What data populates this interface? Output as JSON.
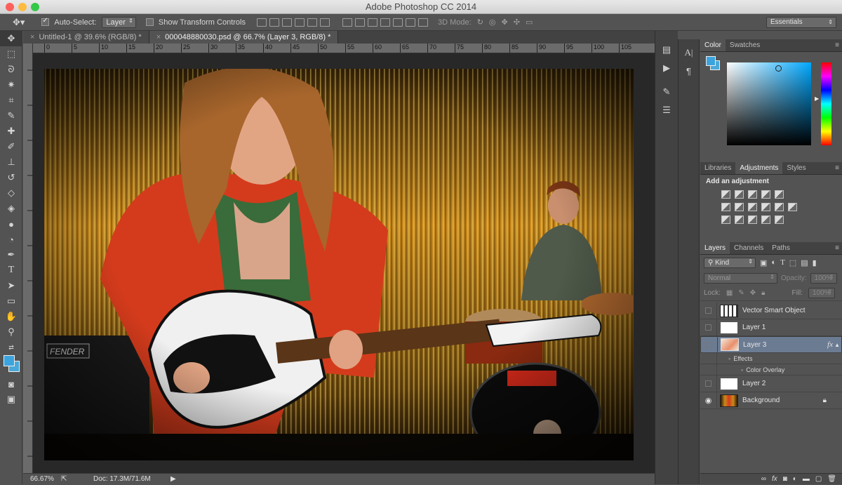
{
  "window": {
    "title": "Adobe Photoshop CC 2014"
  },
  "options": {
    "auto_select_label": "Auto-Select:",
    "auto_select_value": "Layer",
    "transform_label": "Show Transform Controls",
    "mode3d_label": "3D Mode:",
    "workspace": "Essentials"
  },
  "documents": [
    {
      "label": "Untitled-1 @ 39.6% (RGB/8) *"
    },
    {
      "label": "000048880030.psd @ 66.7% (Layer 3, RGB/8) *"
    }
  ],
  "ruler": {
    "ticks": [
      "0",
      "5",
      "10",
      "15",
      "20",
      "25",
      "30",
      "35",
      "40",
      "45",
      "50",
      "55",
      "60",
      "65",
      "70",
      "75",
      "80",
      "85",
      "90",
      "95",
      "100",
      "105"
    ]
  },
  "status": {
    "zoom": "66.67%",
    "doc": "Doc: 17.3M/71.6M"
  },
  "color_panel": {
    "tabs": [
      "Color",
      "Swatches"
    ],
    "foreground": "#3ba4de",
    "background": "#4aa8d8"
  },
  "adjustments_panel": {
    "tabs": [
      "Libraries",
      "Adjustments",
      "Styles"
    ],
    "heading": "Add an adjustment"
  },
  "layers_panel": {
    "tabs": [
      "Layers",
      "Channels",
      "Paths"
    ],
    "kind_filter": "Kind",
    "blend_mode": "Normal",
    "opacity_label": "Opacity:",
    "opacity_value": "100%",
    "lock_label": "Lock:",
    "fill_label": "Fill:",
    "fill_value": "100%",
    "layers": [
      {
        "name": "Vector Smart Object",
        "visible": false,
        "selected": false
      },
      {
        "name": "Layer 1",
        "visible": false,
        "selected": false
      },
      {
        "name": "Layer 3",
        "visible": false,
        "selected": true,
        "fx": "fx"
      },
      {
        "name": "Layer 2",
        "visible": false,
        "selected": false
      },
      {
        "name": "Background",
        "visible": true,
        "selected": false
      }
    ],
    "effects_label": "Effects",
    "effect_item": "Color Overlay"
  }
}
